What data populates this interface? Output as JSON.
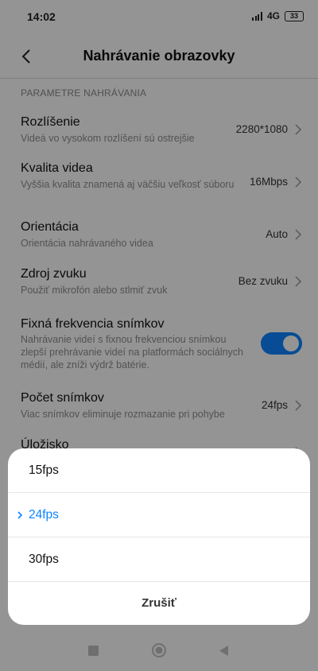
{
  "status_bar": {
    "time": "14:02",
    "network": "4G",
    "battery": "33"
  },
  "header": {
    "title": "Nahrávanie obrazovky"
  },
  "section": {
    "label": "PARAMETRE NAHRÁVANIA"
  },
  "settings": [
    {
      "title": "Rozlíšenie",
      "subtitle": "Videá vo vysokom rozlíšení sú ostrejšie",
      "value": "2280*1080"
    },
    {
      "title": "Kvalita videa",
      "subtitle": "Vyššia kvalita znamená aj väčšiu veľkosť súboru",
      "value": "16Mbps"
    },
    {
      "title": "Orientácia",
      "subtitle": "Orientácia nahrávaného videa",
      "value": "Auto"
    },
    {
      "title": "Zdroj zvuku",
      "subtitle": "Použiť mikrofón alebo stlmiť zvuk",
      "value": "Bez zvuku"
    },
    {
      "title": "Fixná frekvencia snímkov",
      "subtitle": "Nahrávanie videí s fixnou frekvenciou snímkou zlepší prehrávanie videí na platformách sociálnych médií, ale zníži výdrž batérie.",
      "toggle_on": true
    },
    {
      "title": "Počet snímkov",
      "subtitle": "Viac snímkov eliminuje rozmazanie pri pohybe",
      "value": "24fps"
    },
    {
      "title": "Úložisko"
    }
  ],
  "sheet": {
    "options": [
      "15fps",
      "24fps",
      "30fps"
    ],
    "selected_index": 1,
    "cancel_label": "Zrušiť"
  },
  "colors": {
    "accent": "#0d84ff",
    "overlay": "rgba(0,0,0,0.42)"
  }
}
